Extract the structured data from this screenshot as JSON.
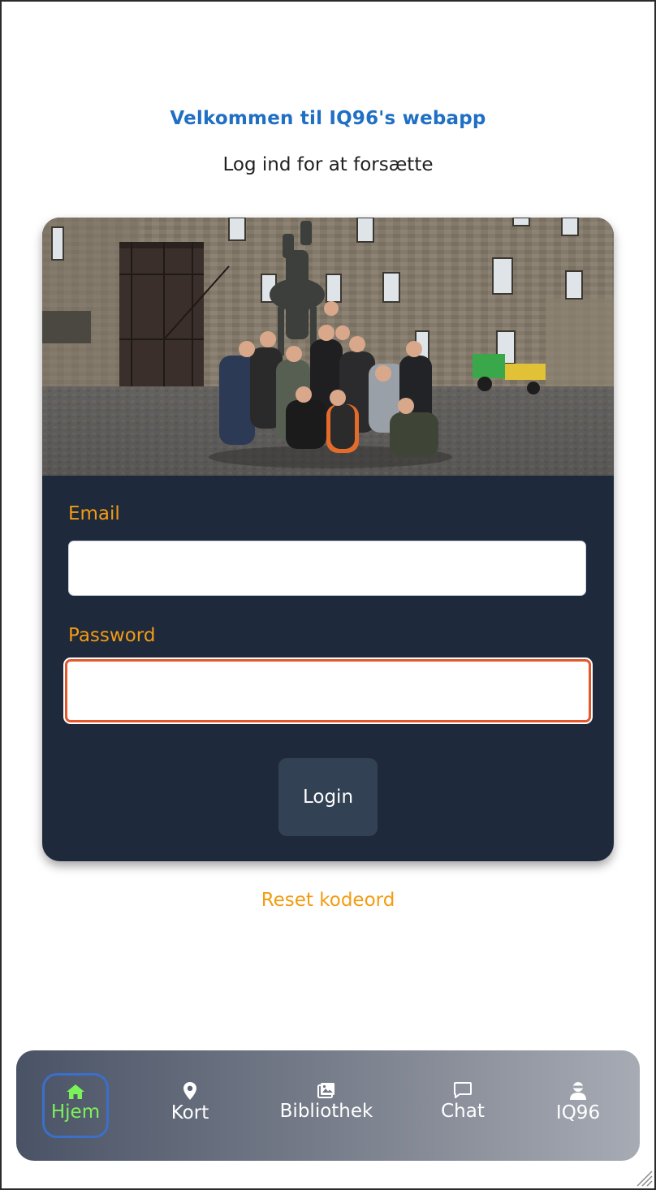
{
  "header": {
    "welcome": "Velkommen til IQ96's webapp",
    "subtitle": "Log ind for at forsætte"
  },
  "login_form": {
    "email_label": "Email",
    "email_value": "",
    "password_label": "Password",
    "password_value": "",
    "login_button": "Login"
  },
  "reset_link": "Reset kodeord",
  "nav": {
    "items": [
      {
        "label": "Hjem",
        "icon": "home-icon",
        "active": true
      },
      {
        "label": "Kort",
        "icon": "map-pin-icon",
        "active": false
      },
      {
        "label": "Bibliothek",
        "icon": "image-gallery-icon",
        "active": false
      },
      {
        "label": "Chat",
        "icon": "chat-icon",
        "active": false
      },
      {
        "label": "IQ96",
        "icon": "user-ninja-icon",
        "active": false
      }
    ]
  },
  "colors": {
    "welcome_text": "#1f6fc5",
    "card_background": "#1e293b",
    "label_orange": "#f39c12",
    "focus_border": "#e3572a",
    "button_background": "#334155",
    "nav_active_text": "#7cf25a",
    "nav_active_border": "#3b6fc9"
  }
}
